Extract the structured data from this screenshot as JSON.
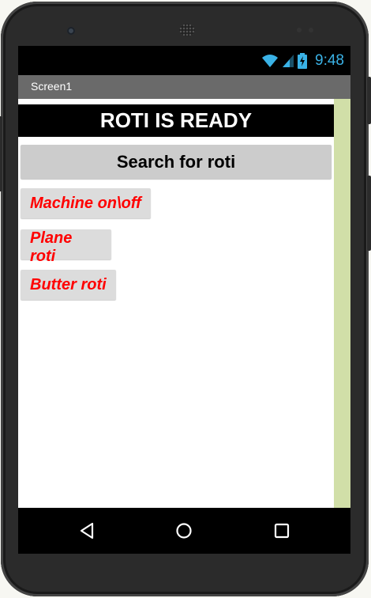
{
  "status_bar": {
    "time": "9:48",
    "icons": [
      "wifi-icon",
      "signal-icon",
      "battery-charging-icon"
    ],
    "accent_color": "#3ab2e6"
  },
  "title_bar": {
    "title": "Screen1",
    "color": "#6a6a6a"
  },
  "screen": {
    "banner": {
      "text": "ROTI IS READY",
      "background": "#000000",
      "color": "#ffffff"
    },
    "search_button": {
      "label": "Search for roti"
    },
    "buttons": [
      {
        "label": "Machine on\\off"
      },
      {
        "label": "Plane roti"
      },
      {
        "label": "Butter roti"
      }
    ],
    "button_text_color": "#ff0000",
    "side_strip_color": "#d1dfa8"
  },
  "nav_bar": {
    "icons": [
      "back-icon",
      "home-icon",
      "recent-apps-icon"
    ]
  }
}
